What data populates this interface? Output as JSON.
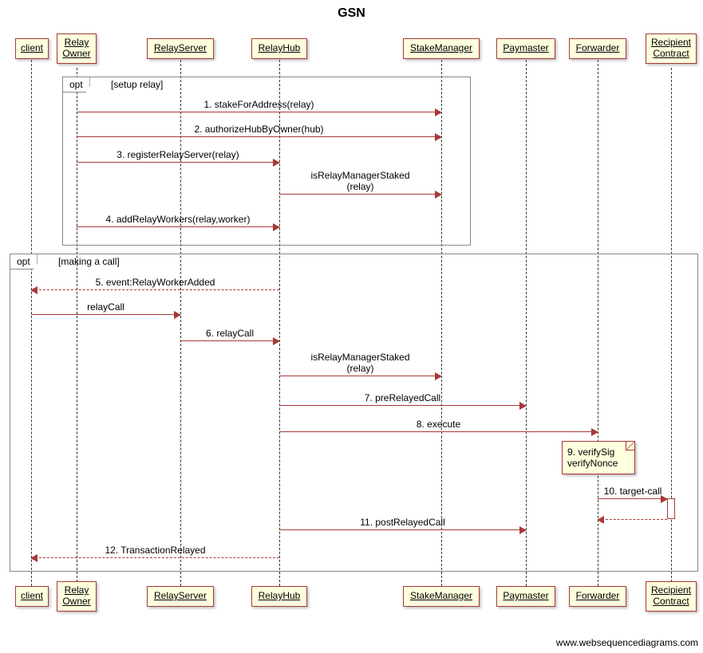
{
  "title": "GSN",
  "participants": [
    {
      "id": "client",
      "label": "client"
    },
    {
      "id": "relayOwner",
      "label": "Relay\nOwner"
    },
    {
      "id": "relayServer",
      "label": "RelayServer"
    },
    {
      "id": "relayHub",
      "label": "RelayHub"
    },
    {
      "id": "stakeManager",
      "label": "StakeManager"
    },
    {
      "id": "paymaster",
      "label": "Paymaster"
    },
    {
      "id": "forwarder",
      "label": "Forwarder"
    },
    {
      "id": "recipient",
      "label": "Recipient\nContract"
    }
  ],
  "frames": [
    {
      "tag": "opt",
      "label": "[setup relay]"
    },
    {
      "tag": "opt",
      "label": "[making a call]"
    }
  ],
  "note": {
    "line1": "9. verifySig",
    "line2": "verifyNonce"
  },
  "messages": {
    "m1": "1. stakeForAddress(relay)",
    "m2": "2. authorizeHubByOwner(hub)",
    "m3": "3. registerRelayServer(relay)",
    "m3b_a": "isRelayManagerStaked",
    "m3b_b": "(relay)",
    "m4": "4. addRelayWorkers(relay,worker)",
    "m5": "5. event:RelayWorkerAdded",
    "m5b": "relayCall",
    "m6": "6. relayCall",
    "m6b_a": "isRelayManagerStaked",
    "m6b_b": "(relay)",
    "m7": "7.  preRelayedCall",
    "m8": "8. execute",
    "m10": "10. target-call",
    "m11": "11. postRelayedCall",
    "m12": "12. TransactionRelayed"
  },
  "attribution": "www.websequencediagrams.com"
}
